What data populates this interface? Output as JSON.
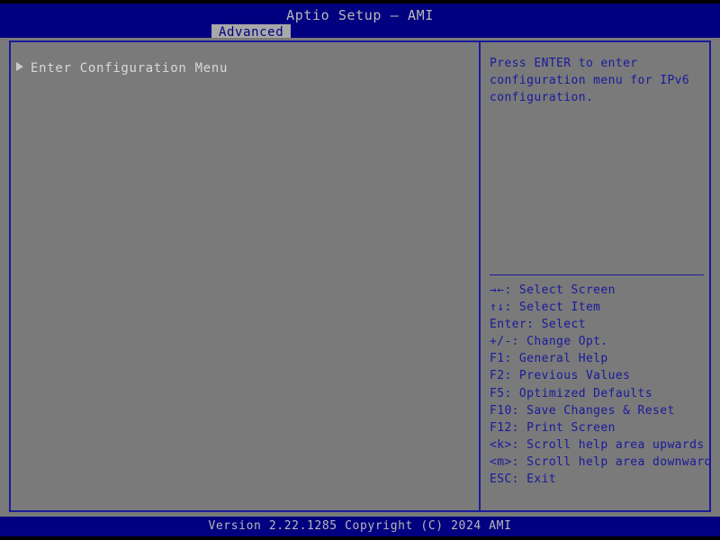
{
  "header": {
    "title": "Aptio Setup – AMI",
    "active_tab": "Advanced",
    "tabs": [
      "Advanced"
    ]
  },
  "left_panel": {
    "items": [
      {
        "label": "Enter Configuration Menu",
        "bullet": "triangle-right-icon",
        "submenu": true
      }
    ]
  },
  "right_panel": {
    "help": [
      "Press ENTER to enter",
      "configuration menu for IPv6",
      "configuration."
    ],
    "key_legend": [
      "→←: Select Screen",
      "↑↓: Select Item",
      "Enter: Select",
      "+/-: Change Opt.",
      "F1: General Help",
      "F2: Previous Values",
      "F5: Optimized Defaults",
      "F10: Save Changes & Reset",
      "F12: Print Screen",
      "<k>: Scroll help area upwards",
      "<m>: Scroll help area downwards",
      "ESC: Exit"
    ]
  },
  "footer": {
    "version_text": "Version 2.22.1285 Copyright (C) 2024 AMI"
  },
  "colors": {
    "header_blue": "#000080",
    "panel_gray": "#7a7a7a",
    "border_blue": "#1a1a9c",
    "text_light": "#b8b8b8",
    "text_blue": "#1a1a9c",
    "tab_bg": "#a8a8a8",
    "background_black": "#000000"
  }
}
